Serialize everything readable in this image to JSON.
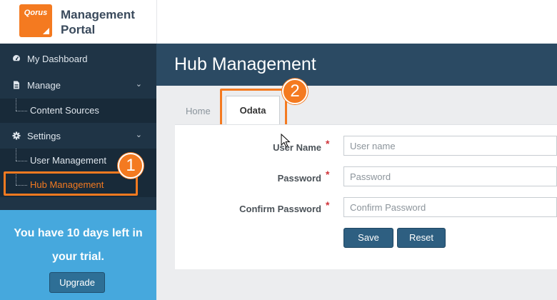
{
  "brand": {
    "logo_text": "Qorus",
    "title_line1": "Management",
    "title_line2": "Portal"
  },
  "sidebar": {
    "items": [
      {
        "label": "My Dashboard",
        "icon": "dashboard-icon"
      },
      {
        "label": "Manage",
        "icon": "document-icon",
        "expanded": true
      },
      {
        "label": "Content Sources"
      },
      {
        "label": "Settings",
        "icon": "gear-icon",
        "expanded": true
      },
      {
        "label": "User Management"
      },
      {
        "label": "Hub Management",
        "active": true
      }
    ]
  },
  "trial": {
    "prefix": "You have ",
    "days": "10 days",
    "suffix": " left in",
    "line2": "your trial.",
    "upgrade_label": "Upgrade"
  },
  "header": {
    "title": "Hub Management"
  },
  "tabs": {
    "home": "Home",
    "odata": "Odata"
  },
  "form": {
    "username_label": "User Name",
    "username_placeholder": "User name",
    "password_label": "Password",
    "password_placeholder": "Password",
    "confirm_label": "Confirm Password",
    "confirm_placeholder": "Confirm Password",
    "required_mark": "*",
    "save_label": "Save",
    "reset_label": "Reset"
  },
  "callouts": {
    "step1": "1",
    "step2": "2"
  },
  "colors": {
    "accent": "#f47a20",
    "sidebar_bg": "#1f3446",
    "header_bg": "#2b4a63",
    "trial_bg": "#46a8dd",
    "button_bg": "#2e5f81"
  }
}
